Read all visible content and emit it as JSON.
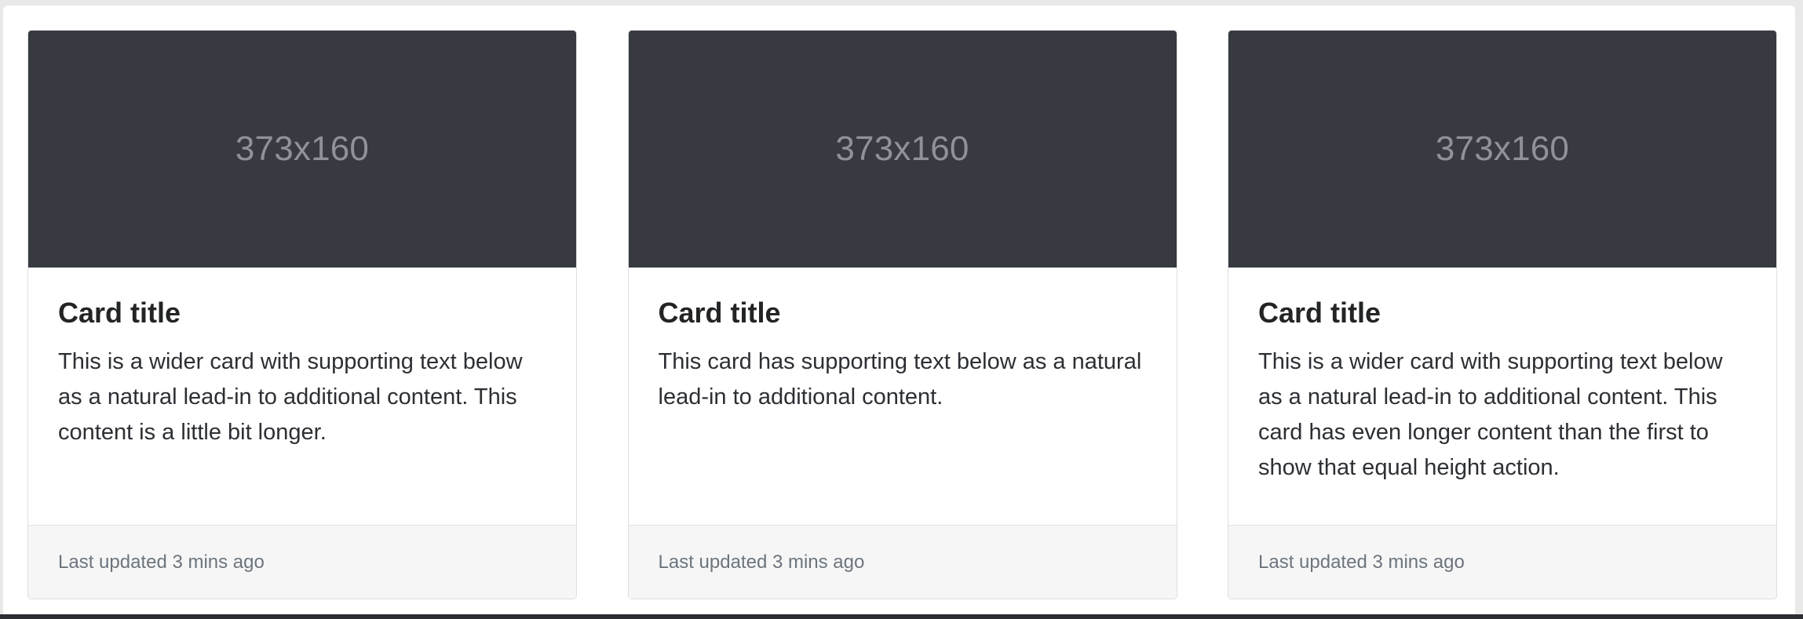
{
  "cards": [
    {
      "image_label": "373x160",
      "title": "Card title",
      "text": "This is a wider card with supporting text below as a natural lead-in to additional content. This content is a little bit longer.",
      "footer": "Last updated 3 mins ago"
    },
    {
      "image_label": "373x160",
      "title": "Card title",
      "text": "This card has supporting text below as a natural lead-in to additional content.",
      "footer": "Last updated 3 mins ago"
    },
    {
      "image_label": "373x160",
      "title": "Card title",
      "text": "This is a wider card with supporting text below as a natural lead-in to additional content. This card has even longer content than the first to show that equal height action.",
      "footer": "Last updated 3 mins ago"
    }
  ],
  "colors": {
    "image_placeholder_bg": "#373a41",
    "image_placeholder_text": "#8f9298",
    "footer_bg": "#f6f6f6",
    "muted_text": "#6c757d"
  }
}
